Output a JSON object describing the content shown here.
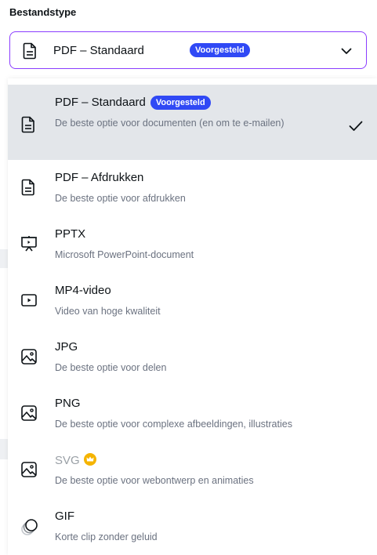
{
  "label": "Bestandstype",
  "select": {
    "value": "PDF – Standaard",
    "badge": "Voorgesteld"
  },
  "options": [
    {
      "title": "PDF – Standaard",
      "badge": "Voorgesteld",
      "desc": "De beste optie voor documenten (en om te e-mailen)",
      "icon": "document-icon",
      "selected": true
    },
    {
      "title": "PDF – Afdrukken",
      "desc": "De beste optie voor afdrukken",
      "icon": "document-icon"
    },
    {
      "title": "PPTX",
      "desc": "Microsoft PowerPoint-document",
      "icon": "presentation-icon"
    },
    {
      "title": "MP4-video",
      "desc": "Video van hoge kwaliteit",
      "icon": "video-icon"
    },
    {
      "title": "JPG",
      "desc": "De beste optie voor delen",
      "icon": "image-icon"
    },
    {
      "title": "PNG",
      "desc": "De beste optie voor complexe afbeeldingen, illustraties",
      "icon": "image-icon"
    },
    {
      "title": "SVG",
      "desc": "De beste optie voor webontwerp en animaties",
      "icon": "image-icon",
      "premium": true
    },
    {
      "title": "GIF",
      "desc": "Korte clip zonder geluid",
      "icon": "gif-icon"
    }
  ],
  "colors": {
    "accent": "#8b3dff",
    "badge": "#3049f5",
    "selected_bg": "#e3e6ea",
    "crown": "#f5b400"
  }
}
